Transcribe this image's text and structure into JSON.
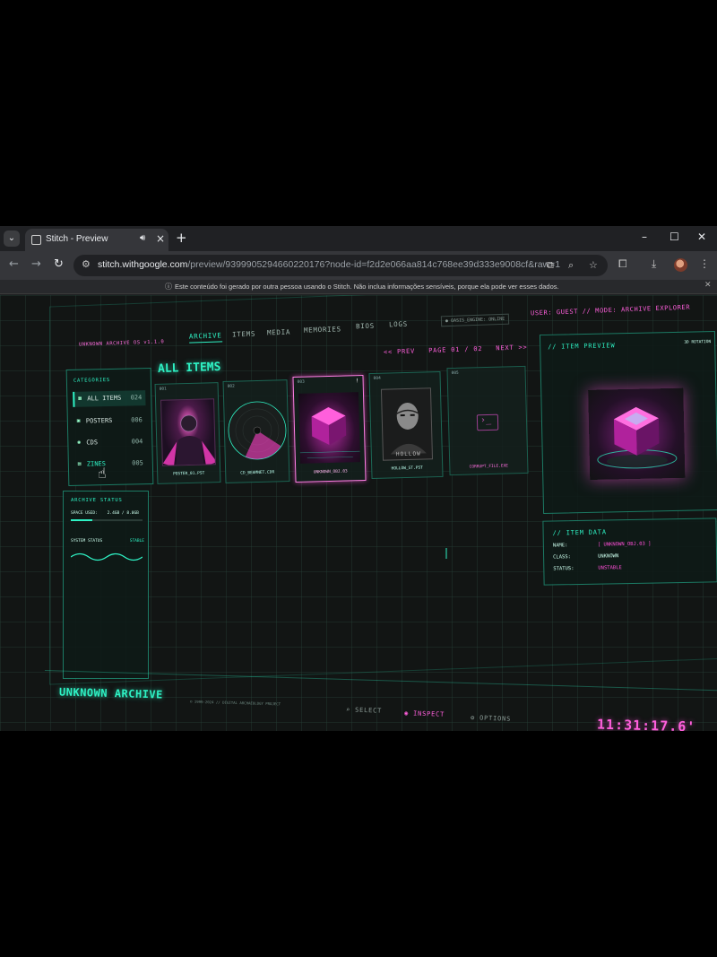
{
  "browser": {
    "tab_title": "Stitch - Preview",
    "url_host": "stitch.withgoogle.com",
    "url_path": "/preview/9399905294660220176?node-id=f2d2e066aa814c768ee39d333e9008cf&raw=1",
    "infobar_message": "Este conteúdo foi gerado por outra pessoa usando o Stitch. Não inclua informações sensíveis, porque ela pode ver esses dados."
  },
  "app": {
    "brand": "UNKNOWN ARCHIVE OS v1.1.0",
    "nav": [
      "ARCHIVE",
      "ITEMS",
      "MEDIA",
      "MEMORIES",
      "BIOS",
      "LOGS"
    ],
    "engine": "● OASIS_ENGINE: ONLINE",
    "user_mode": "USER: GUEST // MODE: ARCHIVE EXPLORER",
    "categories_title": "CATEGORIES",
    "categories": [
      {
        "icon": "grid-icon",
        "label": "ALL ITEMS",
        "count": "024"
      },
      {
        "icon": "poster-icon",
        "label": "POSTERS",
        "count": "006"
      },
      {
        "icon": "disc-icon",
        "label": "CDS",
        "count": "004"
      },
      {
        "icon": "zine-icon",
        "label": "ZINES",
        "count": "005"
      }
    ],
    "status": {
      "title": "ARCHIVE STATUS",
      "space_label": "SPACE USED:",
      "space_value": "2.4GB / 8.0GB",
      "space_fraction": 0.3,
      "system_label": "SYSTEM STATUS",
      "system_value": "STABLE"
    },
    "items_title": "ALL ITEMS",
    "pager": {
      "prev": "<< PREV",
      "page": "PAGE 01 / 02",
      "next": "NEXT >>"
    },
    "items": [
      {
        "num": "001",
        "file": "POSTER_01.PST"
      },
      {
        "num": "002",
        "file": "CD_BEAMNET.CDR"
      },
      {
        "num": "003",
        "file": "UNKNOWN_OBJ.03"
      },
      {
        "num": "004",
        "file": "HOLLOW_ST.PST",
        "art_text": "HOLLOW"
      },
      {
        "num": "005",
        "file": "CORRUPT_FILE.EXE"
      }
    ],
    "preview": {
      "title": "// ITEM PREVIEW",
      "badge": "3D ROTATION"
    },
    "item_data": {
      "title": "// ITEM DATA",
      "rows": [
        {
          "key": "NAME:",
          "value": "[ UNKNOWN_OBJ.03 ]"
        },
        {
          "key": "CLASS:",
          "value": "UNKNOWN"
        },
        {
          "key": "STATUS:",
          "value": "UNSTABLE"
        }
      ]
    },
    "footer": {
      "title": "UNKNOWN ARCHIVE",
      "subtitle": "© 1999-2024 // DIGITAL ARCHAEOLOGY PROJECT",
      "buttons": [
        "SELECT",
        "INSPECT",
        "OPTIONS"
      ],
      "clock": "11:31:17.6'"
    }
  },
  "colors": {
    "accent_teal": "#2ef2c4",
    "accent_pink": "#ff4fd8",
    "background": "#121514"
  }
}
